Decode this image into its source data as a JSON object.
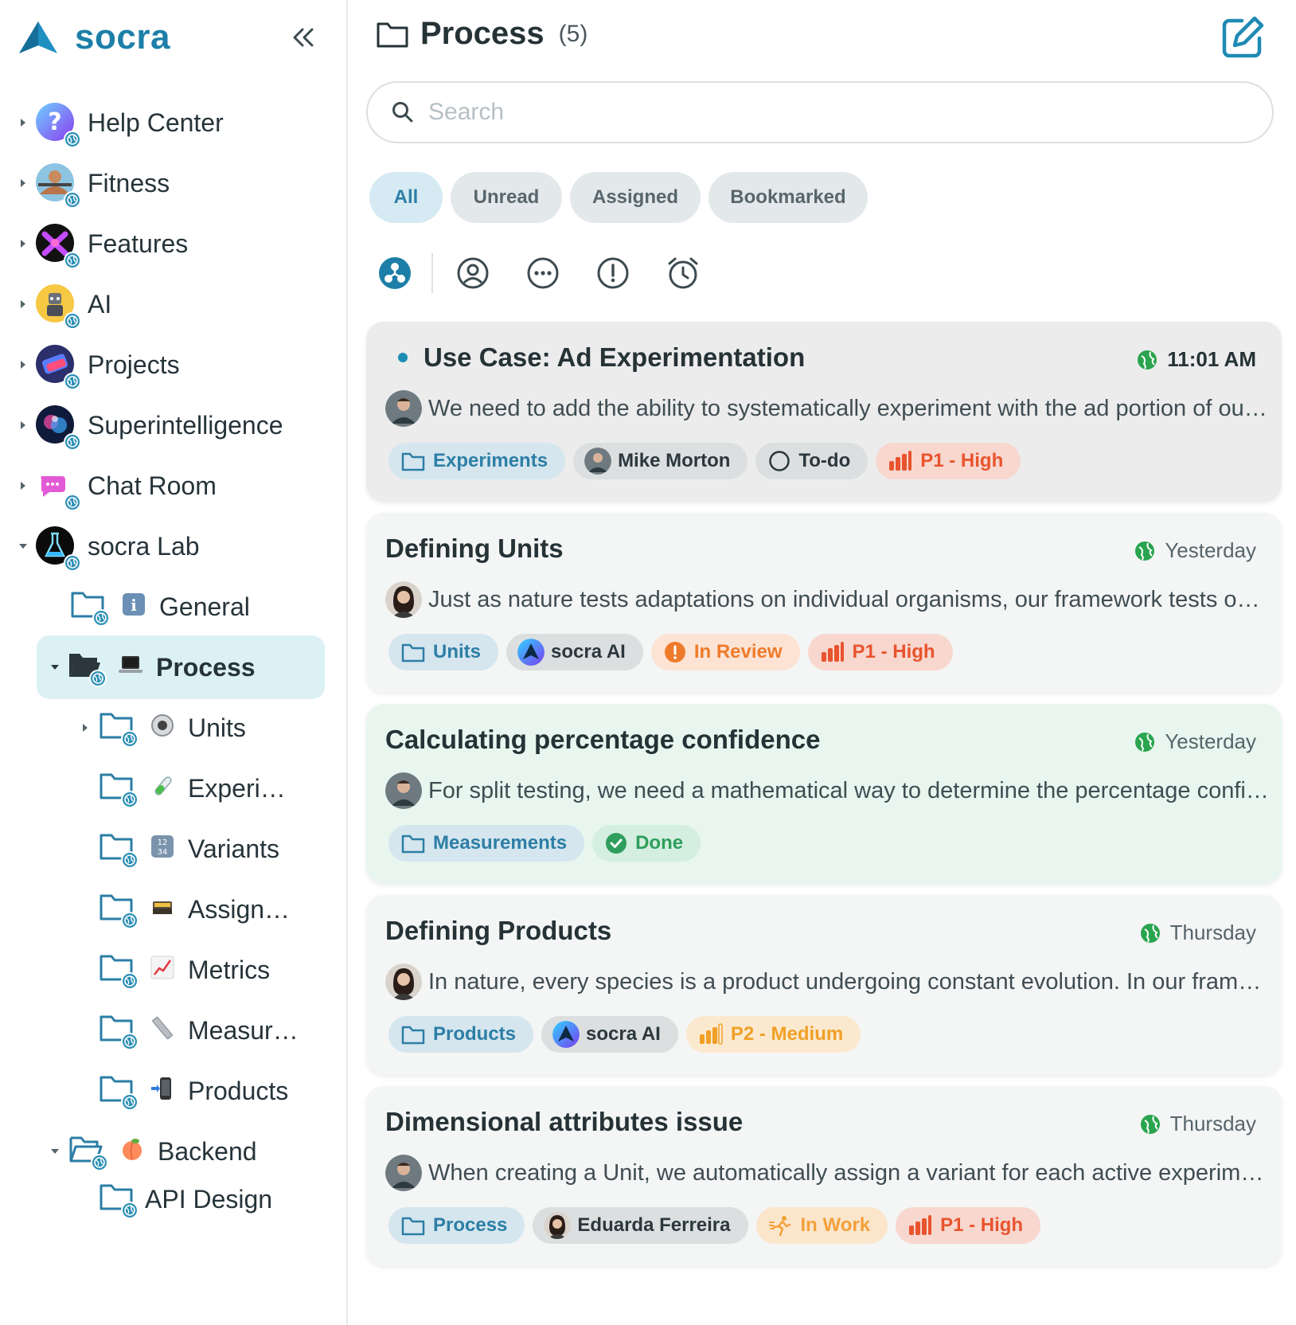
{
  "app": {
    "name": "socra"
  },
  "sidebar": {
    "items": [
      {
        "label": "Help Center",
        "icon": "question-icon"
      },
      {
        "label": "Fitness",
        "icon": "fitness-icon"
      },
      {
        "label": "Features",
        "icon": "features-icon"
      },
      {
        "label": "AI",
        "icon": "robot-icon"
      },
      {
        "label": "Projects",
        "icon": "projects-icon"
      },
      {
        "label": "Superintelligence",
        "icon": "brain-icon"
      },
      {
        "label": "Chat Room",
        "icon": "chat-icon"
      },
      {
        "label": "socra Lab",
        "icon": "flask-icon"
      }
    ],
    "lab_children": [
      {
        "label": "General",
        "emoji": "ℹ"
      },
      {
        "label": "Process",
        "emoji": "💻"
      }
    ],
    "process_children": [
      {
        "label": "Units",
        "emoji": "◉"
      },
      {
        "label": "Experi…",
        "emoji": "🧪"
      },
      {
        "label": "Variants",
        "emoji": "🔢"
      },
      {
        "label": "Assign…",
        "emoji": "🗃"
      },
      {
        "label": "Metrics",
        "emoji": "📈"
      },
      {
        "label": "Measur…",
        "emoji": "📏"
      },
      {
        "label": "Products",
        "emoji": "📲"
      }
    ],
    "backend": {
      "label": "Backend",
      "emoji": "🍑"
    },
    "backend_children": [
      {
        "label": "API Design"
      }
    ]
  },
  "header": {
    "title": "Process",
    "count": "(5)"
  },
  "search": {
    "placeholder": "Search"
  },
  "filters": [
    "All",
    "Unread",
    "Assigned",
    "Bookmarked"
  ],
  "threads": [
    {
      "title": "Use Case: Ad Experimentation",
      "time": "11:01 AM",
      "preview": "We need to add the ability to systematically experiment with the ad portion of our product",
      "folder": "Experiments",
      "assignee": "Mike Morton",
      "status": "To-do",
      "priority": "P1 - High"
    },
    {
      "title": "Defining Units",
      "time": "Yesterday",
      "preview": "Just as nature tests adaptations on individual organisms, our framework tests on units",
      "folder": "Units",
      "assignee": "socra AI",
      "status": "In Review",
      "priority": "P1 - High"
    },
    {
      "title": "Calculating percentage confidence",
      "time": "Yesterday",
      "preview": "For split testing, we need a mathematical way to determine the percentage confidence",
      "folder": "Measurements",
      "status": "Done"
    },
    {
      "title": "Defining Products",
      "time": "Thursday",
      "preview": "In nature, every species is a product undergoing constant evolution. In our framework",
      "folder": "Products",
      "assignee": "socra AI",
      "priority": "P2 - Medium"
    },
    {
      "title": "Dimensional attributes issue",
      "time": "Thursday",
      "preview": "When creating a Unit, we automatically assign a variant for each active experiment",
      "folder": "Process",
      "assignee": "Eduarda Ferreira",
      "status": "In Work",
      "priority": "P1 - High"
    }
  ],
  "colors": {
    "brand": "#1d7fa8",
    "active_bg": "#dcf1f6",
    "high": "#e8542e",
    "done": "#2e9e5c"
  }
}
